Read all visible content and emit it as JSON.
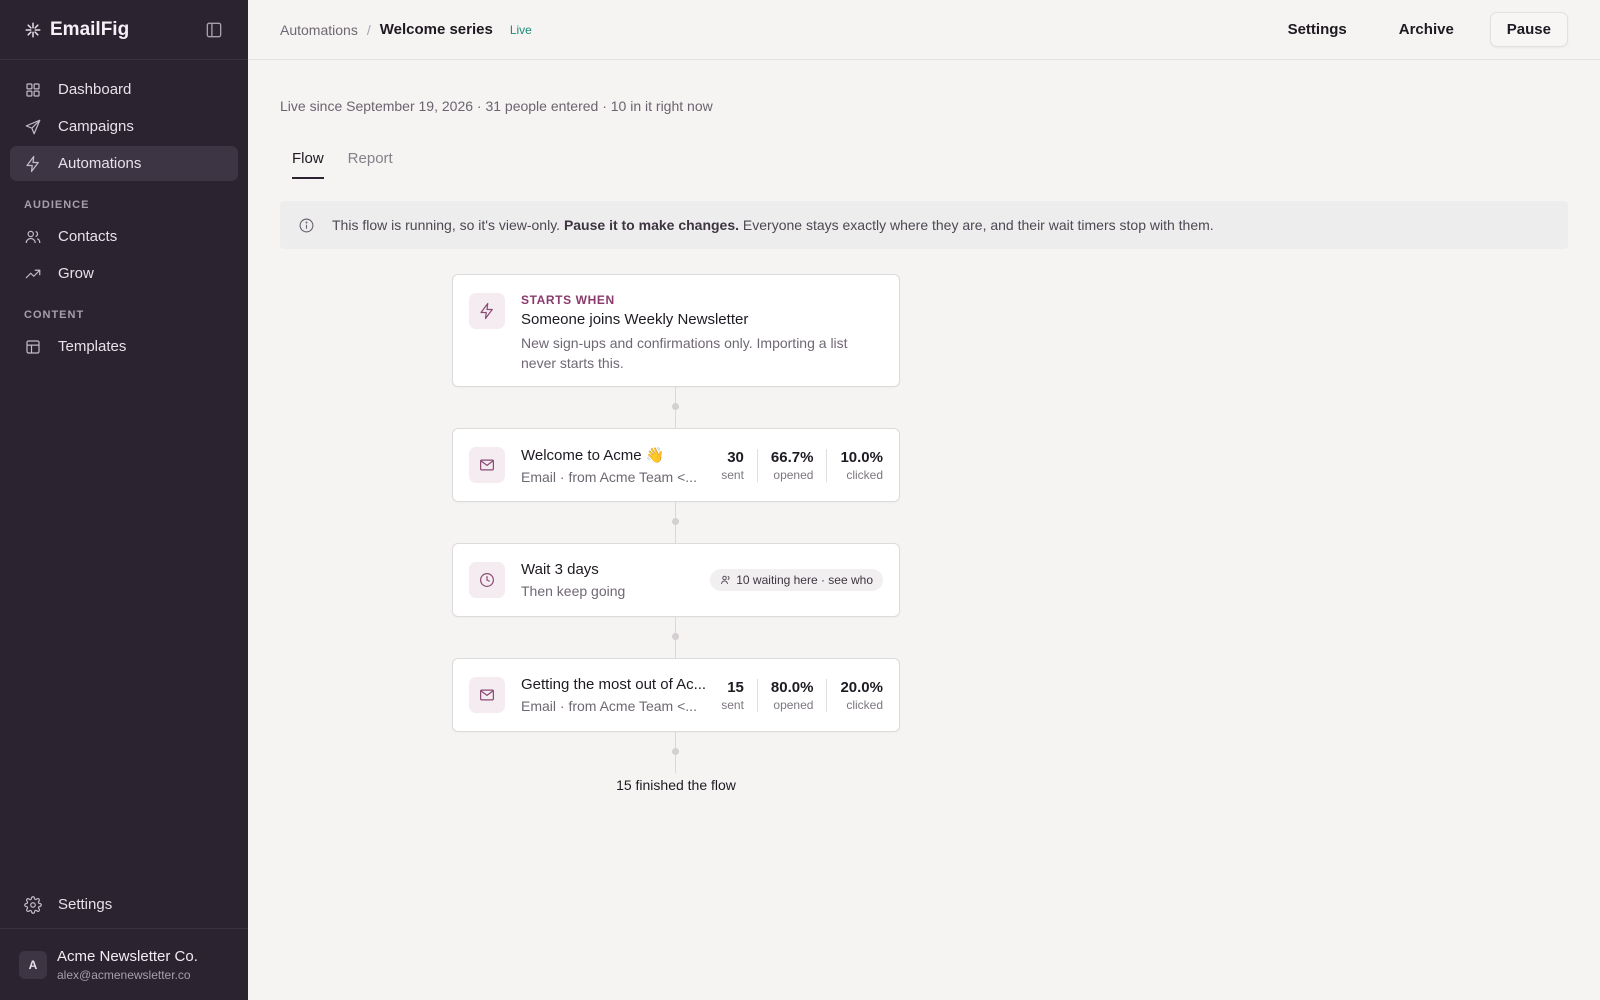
{
  "sidebar": {
    "brand": "EmailFig",
    "items_top": [
      {
        "label": "Dashboard",
        "icon": "dashboard-icon"
      },
      {
        "label": "Campaigns",
        "icon": "send-icon"
      },
      {
        "label": "Automations",
        "icon": "bolt-icon",
        "active": true
      }
    ],
    "section_audience": "AUDIENCE",
    "items_audience": [
      {
        "label": "Contacts",
        "icon": "users-icon"
      },
      {
        "label": "Grow",
        "icon": "trending-up-icon"
      }
    ],
    "section_content": "CONTENT",
    "items_content": [
      {
        "label": "Templates",
        "icon": "template-icon"
      }
    ],
    "settings_label": "Settings",
    "account": {
      "initial": "A",
      "name": "Acme Newsletter Co.",
      "email": "alex@acmenewsletter.co"
    }
  },
  "header": {
    "breadcrumb_root": "Automations",
    "breadcrumb_sep": "/",
    "breadcrumb_current": "Welcome series",
    "status_badge": "Live",
    "actions": {
      "settings": "Settings",
      "archive": "Archive",
      "pause": "Pause"
    }
  },
  "main": {
    "meta": "Live since September 19, 2026 · 31 people entered · 10 in it right now",
    "tabs": [
      {
        "label": "Flow",
        "active": true
      },
      {
        "label": "Report"
      }
    ],
    "banner": {
      "prefix": "This flow is running, so it's view-only.",
      "bold": "Pause it to make changes.",
      "suffix": "Everyone stays exactly where they are, and their wait timers stop with them."
    },
    "flow": {
      "trigger": {
        "eyebrow": "STARTS WHEN",
        "title": "Someone joins Weekly Newsletter",
        "desc": "New sign-ups and confirmations only. Importing a list never starts this."
      },
      "email1": {
        "title": "Welcome to Acme 👋",
        "sub": "Email · from Acme Team <...",
        "stats": [
          {
            "value": "30",
            "label": "sent"
          },
          {
            "value": "66.7%",
            "label": "opened"
          },
          {
            "value": "10.0%",
            "label": "clicked"
          }
        ]
      },
      "wait": {
        "title": "Wait 3 days",
        "sub": "Then keep going",
        "pill": "10 waiting here · see who"
      },
      "email2": {
        "title": "Getting the most out of Ac...",
        "sub": "Email · from Acme Team <...",
        "stats": [
          {
            "value": "15",
            "label": "sent"
          },
          {
            "value": "80.0%",
            "label": "opened"
          },
          {
            "value": "20.0%",
            "label": "clicked"
          }
        ]
      },
      "finished": "15 finished the flow"
    }
  },
  "colors": {
    "sidebar_bg": "#2b2430",
    "accent": "#8a3a6c",
    "live": "#1f8a78",
    "page_bg": "#f5f4f2"
  }
}
